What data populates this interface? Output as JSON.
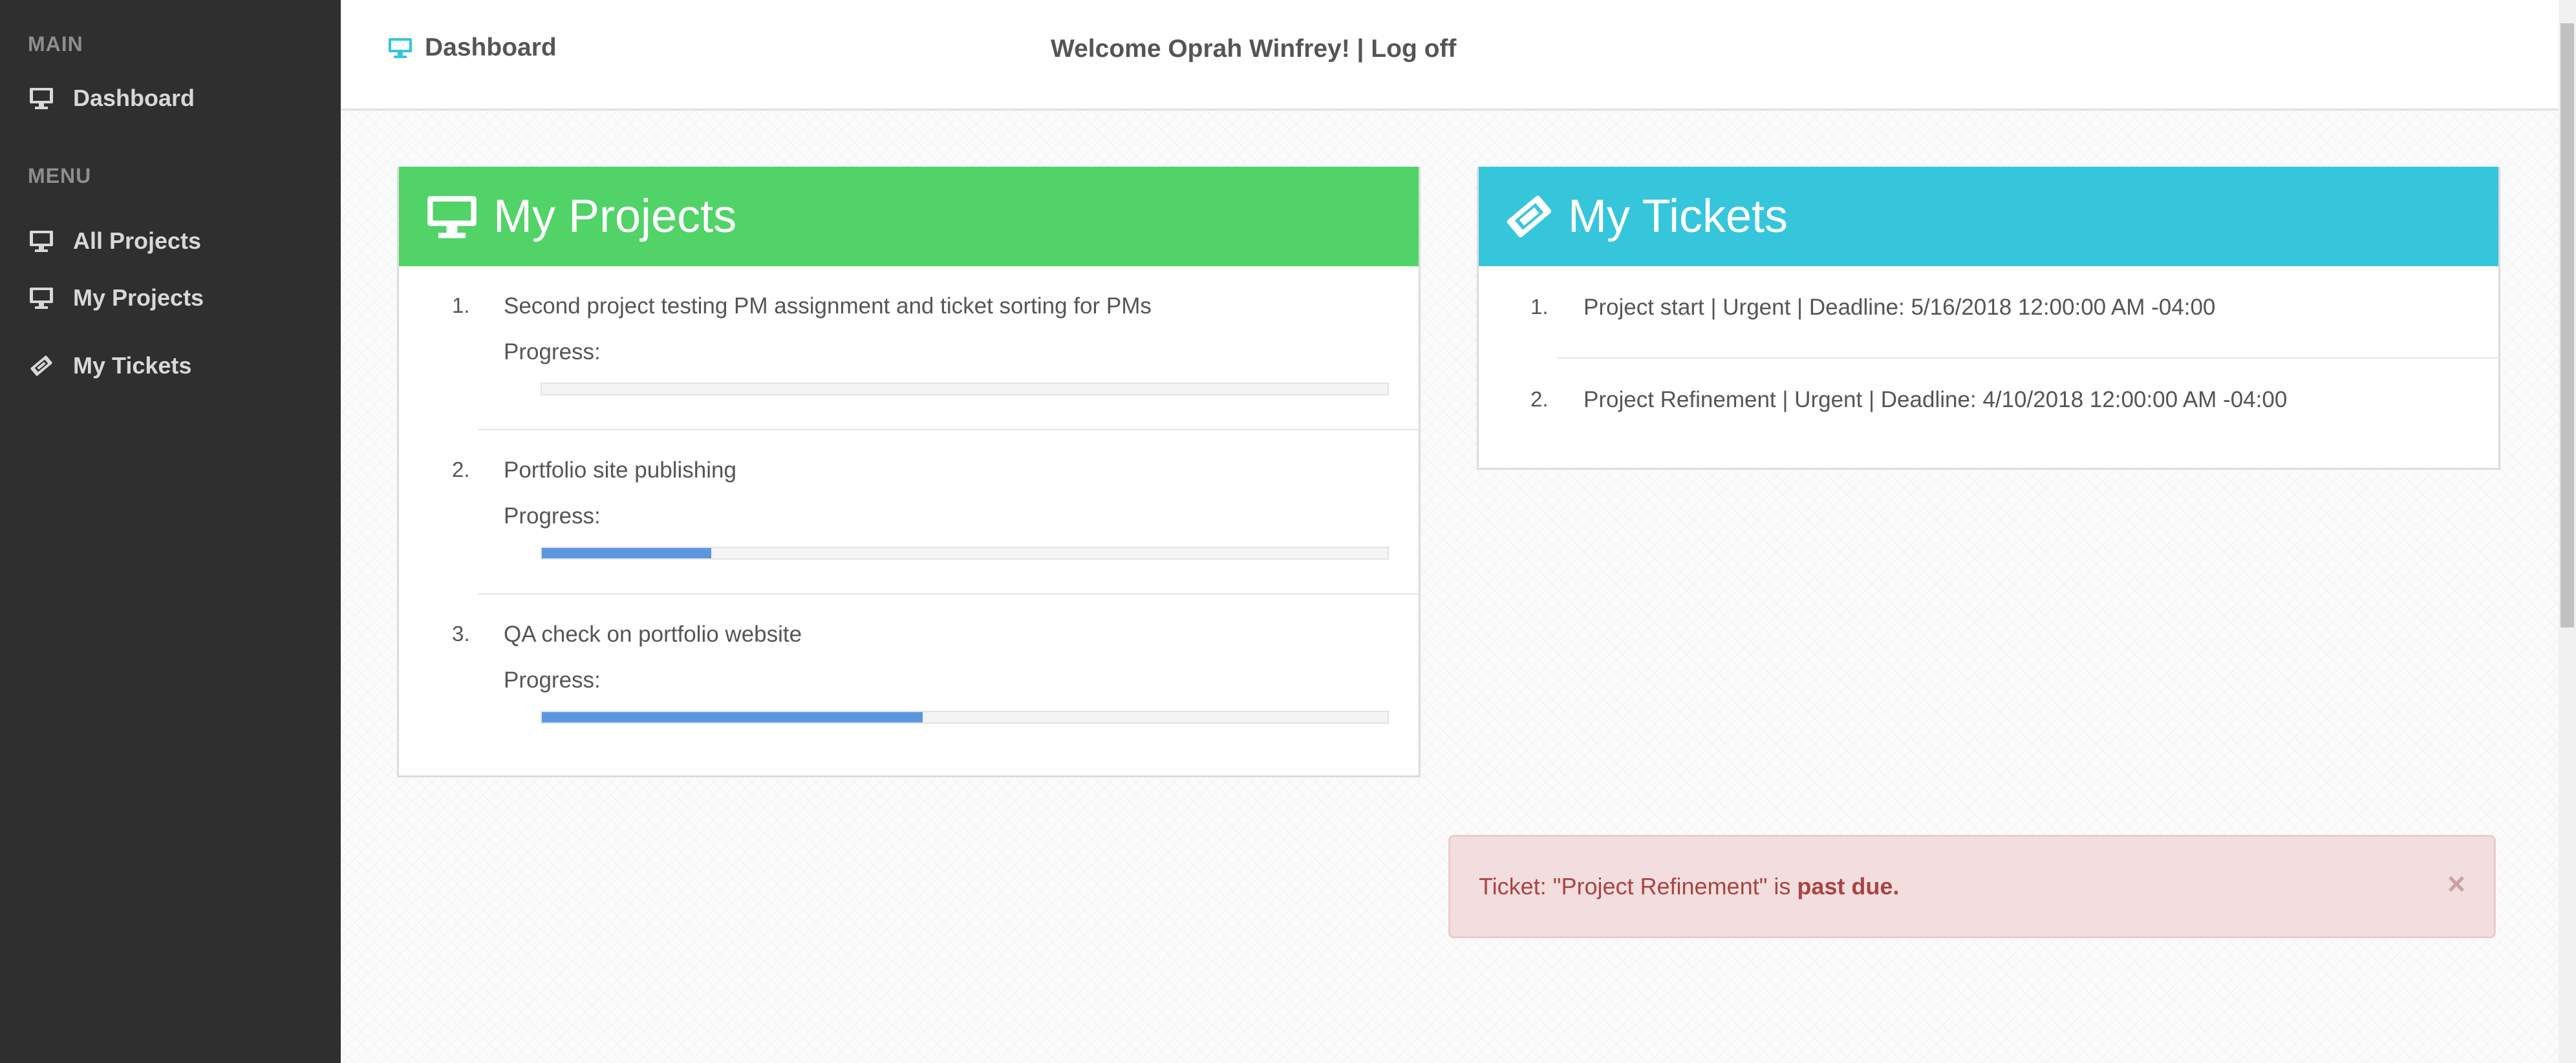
{
  "sidebar": {
    "main_heading": "MAIN",
    "main_items": [
      {
        "label": "Dashboard",
        "icon": "monitor-icon"
      }
    ],
    "menu_heading": "MENU",
    "menu_items": [
      {
        "label": "All Projects",
        "icon": "monitor-icon"
      },
      {
        "label": "My Projects",
        "icon": "monitor-icon"
      },
      {
        "label": "My Tickets",
        "icon": "ticket-icon"
      }
    ]
  },
  "topbar": {
    "brand_label": "Dashboard",
    "brand_icon": "monitor-icon",
    "welcome_text": "Welcome Oprah Winfrey!",
    "separator": "|",
    "logoff_label": "Log off"
  },
  "projects_panel": {
    "title": "My Projects",
    "icon": "monitor-icon",
    "header_color": "#51d368",
    "progress_label": "Progress:",
    "items": [
      {
        "number": "1.",
        "name": "Second project testing PM assignment and ticket sorting for PMs",
        "progress": 0
      },
      {
        "number": "2.",
        "name": "Portfolio site publishing",
        "progress": 20
      },
      {
        "number": "3.",
        "name": "QA check on portfolio website",
        "progress": 45
      }
    ]
  },
  "tickets_panel": {
    "title": "My Tickets",
    "icon": "ticket-icon",
    "header_color": "#36c6dc",
    "items": [
      {
        "number": "1.",
        "text": "Project start | Urgent | Deadline: 5/16/2018 12:00:00 AM -04:00"
      },
      {
        "number": "2.",
        "text": "Project Refinement | Urgent | Deadline: 4/10/2018 12:00:00 AM -04:00"
      }
    ]
  },
  "alert": {
    "prefix": "Ticket: \"Project Refinement\" is ",
    "emphasis": "past due.",
    "close_label": "×"
  }
}
